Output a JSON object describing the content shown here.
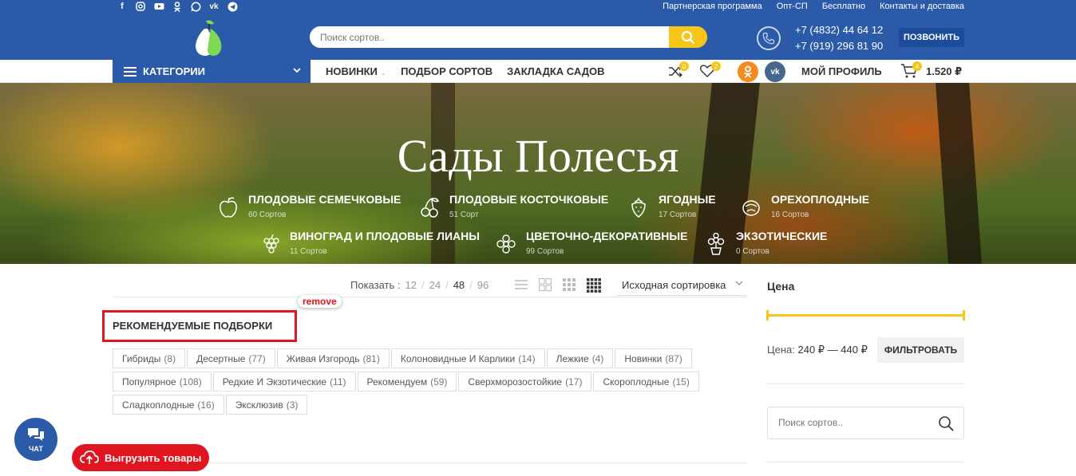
{
  "topbar": {
    "socials": [
      "facebook-icon",
      "instagram-icon",
      "youtube-icon",
      "odnoklassniki-icon",
      "whatsapp-icon",
      "vk-icon",
      "telegram-icon"
    ],
    "links": [
      "Партнерская программа",
      "Опт-СП",
      "Бесплатно",
      "Контакты и доставка"
    ]
  },
  "header": {
    "search_placeholder": "Поиск сортов..",
    "phones": [
      "+7 (4832) 44 64 12",
      "+7 (919) 296 81 90"
    ],
    "call_label": "ПОЗВОНИТЬ"
  },
  "nav": {
    "categories_label": "КАТЕГОРИИ",
    "links": [
      "НОВИНКИ",
      "ПОДБОР СОРТОВ",
      "ЗАКЛАДКА САДОВ"
    ],
    "compare_count": "0",
    "wishlist_count": "2",
    "profile_label": "МОЙ ПРОФИЛЬ",
    "cart_count": "4",
    "cart_total": "1.520 ₽"
  },
  "hero": {
    "title": "Сады Полесья",
    "categories": [
      {
        "label": "ПЛОДОВЫЕ СЕМЕЧКОВЫЕ",
        "count": "60 Сортов",
        "icon": "apple-icon"
      },
      {
        "label": "ПЛОДОВЫЕ КОСТОЧКОВЫЕ",
        "count": "51 Сорт",
        "icon": "cherry-icon"
      },
      {
        "label": "ЯГОДНЫЕ",
        "count": "17 Сортов",
        "icon": "strawberry-icon"
      },
      {
        "label": "ОРЕХОПЛОДНЫЕ",
        "count": "16 Сортов",
        "icon": "nut-icon"
      },
      {
        "label": "ВИНОГРАД И ПЛОДОВЫЕ ЛИАНЫ",
        "count": "11 Сортов",
        "icon": "grape-icon"
      },
      {
        "label": "ЦВЕТОЧНО-ДЕКОРАТИВНЫЕ",
        "count": "99 Сортов",
        "icon": "flower-icon"
      },
      {
        "label": "ЭКЗОТИЧЕСКИЕ",
        "count": "0 Сортов",
        "icon": "exotic-plant-icon"
      }
    ]
  },
  "toolbar": {
    "show_label": "Показать :",
    "counts": [
      "12",
      "24",
      "48",
      "96"
    ],
    "active_count": "48",
    "sort_label": "Исходная сортировка"
  },
  "recommended": {
    "title": "РЕКОМЕНДУЕМЫЕ ПОДБОРКИ",
    "remove_label": "remove",
    "tags": [
      {
        "name": "Гибриды",
        "count": "(8)"
      },
      {
        "name": "Десертные",
        "count": "(77)"
      },
      {
        "name": "Живая Изгородь",
        "count": "(81)"
      },
      {
        "name": "Колоновидные И Карлики",
        "count": "(14)"
      },
      {
        "name": "Лежкие",
        "count": "(4)"
      },
      {
        "name": "Новинки",
        "count": "(87)"
      },
      {
        "name": "Популярное",
        "count": "(108)"
      },
      {
        "name": "Редкие И Экзотические",
        "count": "(11)"
      },
      {
        "name": "Рекомендуем",
        "count": "(59)"
      },
      {
        "name": "Сверхморозостойкие",
        "count": "(17)"
      },
      {
        "name": "Скороплодные",
        "count": "(15)"
      },
      {
        "name": "Сладкоплодные",
        "count": "(16)"
      },
      {
        "name": "Эксклюзив",
        "count": "(3)"
      }
    ]
  },
  "sidebar": {
    "price_title": "Цена",
    "price_label": "Цена:",
    "price_range": "240 ₽ — 440 ₽",
    "filter_label": "ФИЛЬТРОВАТЬ",
    "search_placeholder": "Поиск сортов.."
  },
  "floating": {
    "chat_label": "ЧАТ",
    "export_label": "Выгрузить товары"
  },
  "colors": {
    "brand_blue": "#2b5aa8",
    "accent_yellow": "#f5c518",
    "alert_red": "#e0151f"
  }
}
